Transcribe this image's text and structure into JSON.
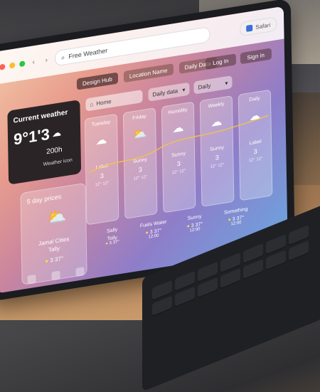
{
  "browser": {
    "url_text": "Free Weather",
    "extension_label": "Safari"
  },
  "tabs": [
    {
      "label": "Design Hub"
    },
    {
      "label": "Location Name"
    },
    {
      "label": "Daily Data"
    }
  ],
  "actions": {
    "login": "Log In",
    "sign_in": "Sign in"
  },
  "search": {
    "placeholder": "Home"
  },
  "selects": [
    {
      "label": "Daily data"
    },
    {
      "label": "Daily"
    }
  ],
  "current_weather": {
    "title": "Current weather",
    "temp": "9°1'3",
    "time": "200h",
    "location_button": "Weather icon"
  },
  "hourly": [
    {
      "day": "Tuesday",
      "v1": "Label",
      "v2": "3",
      "v3": "12° 12°"
    },
    {
      "day": "Friday",
      "v1": "Sunny",
      "v2": "3",
      "v3": "12° 12°"
    },
    {
      "day": "Humidity",
      "v1": "Sunny",
      "v2": "3",
      "v3": "12° 12°"
    },
    {
      "day": "Weekly",
      "v1": "Sunny",
      "v2": "3",
      "v3": "12° 12°"
    },
    {
      "day": "Daily",
      "v1": "Label",
      "v2": "3",
      "v3": "12° 12°"
    }
  ],
  "five_day": {
    "title": "5 day prices",
    "r1": "Jamal Cities",
    "r2": "Tally",
    "r3": "3 37°"
  },
  "bottom_cols": [
    {
      "t": "Sally",
      "m": "Tolly",
      "d": "3 37°"
    },
    {
      "t": "Fuels Water",
      "m": "3 37°",
      "d": "12:00"
    },
    {
      "t": "Sunny",
      "m": "3 37°",
      "d": "12:00"
    },
    {
      "t": "Something",
      "m": "3 37°",
      "d": "12:00"
    },
    {
      "t": "Something",
      "m": "3 37°",
      "d": "12:00"
    }
  ],
  "colors": {
    "accent": "#ffd84a",
    "card_dark": "#2b2426"
  }
}
